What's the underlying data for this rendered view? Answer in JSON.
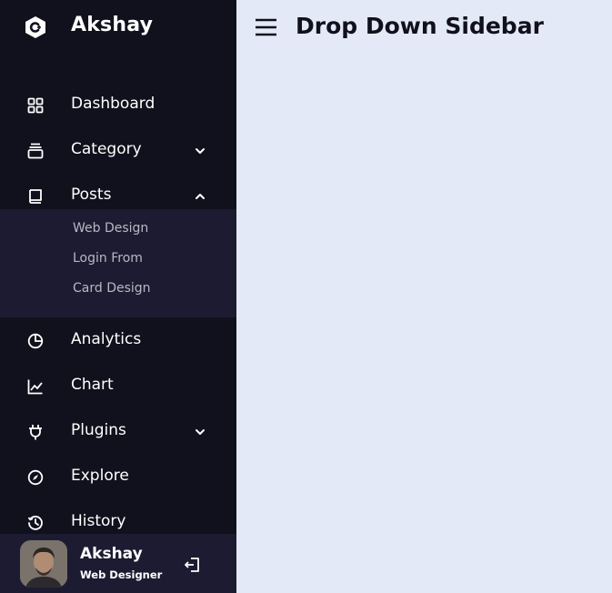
{
  "sidebar": {
    "logo_text": "Akshay",
    "items": [
      {
        "label": "Dashboard"
      },
      {
        "label": "Category"
      },
      {
        "label": "Posts"
      },
      {
        "label": "Analytics"
      },
      {
        "label": "Chart"
      },
      {
        "label": "Plugins"
      },
      {
        "label": "Explore"
      },
      {
        "label": "History"
      }
    ],
    "posts_submenu": [
      "Web Design",
      "Login From",
      "Card Design"
    ]
  },
  "profile": {
    "name": "Akshay",
    "job": "Web Designer"
  },
  "home": {
    "title": "Drop Down Sidebar"
  },
  "colors": {
    "sidebar_bg": "#11101d",
    "submenu_bg": "#1d1b31",
    "page_bg": "#e4e9f7"
  },
  "icons": [
    "logo-icon",
    "grid-icon",
    "collection-icon",
    "book-icon",
    "pie-chart-icon",
    "line-chart-icon",
    "plug-icon",
    "compass-icon",
    "history-icon",
    "logout-icon",
    "menu-icon",
    "chevron-down-icon",
    "chevron-up-icon"
  ]
}
